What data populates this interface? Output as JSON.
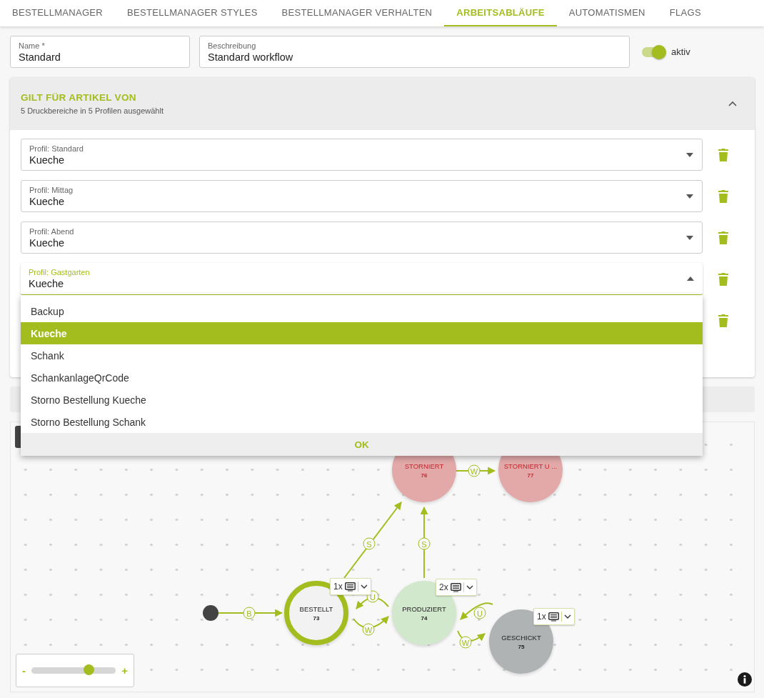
{
  "tabs": [
    {
      "label": "BESTELLMANAGER",
      "selected": false
    },
    {
      "label": "BESTELLMANAGER STYLES",
      "selected": false
    },
    {
      "label": "BESTELLMANAGER VERHALTEN",
      "selected": false
    },
    {
      "label": "ARBEITSABLÄUFE",
      "selected": true
    },
    {
      "label": "AUTOMATISMEN",
      "selected": false
    },
    {
      "label": "FLAGS",
      "selected": false
    }
  ],
  "form": {
    "name": {
      "label": "Name *",
      "value": "Standard"
    },
    "description": {
      "label": "Beschreibung",
      "value": "Standard workflow"
    },
    "active": {
      "label": "aktiv",
      "on": true
    }
  },
  "section": {
    "title": "GILT FÜR ARTIKEL VON",
    "subtitle": "5 Druckbereiche in 5 Profilen ausgewählt",
    "expanded": true
  },
  "profiles": [
    {
      "label": "Profil: Standard",
      "value": "Kueche",
      "open": false
    },
    {
      "label": "Profil: Mittag",
      "value": "Kueche",
      "open": false
    },
    {
      "label": "Profil: Abend",
      "value": "Kueche",
      "open": false
    },
    {
      "label": "Profil: Gastgarten",
      "value": "Kueche",
      "open": true
    },
    {
      "open": false
    }
  ],
  "dropdown": {
    "options": [
      {
        "label": "Backup",
        "selected": false
      },
      {
        "label": "Kueche",
        "selected": true
      },
      {
        "label": "Schank",
        "selected": false
      },
      {
        "label": "SchankanlageQrCode",
        "selected": false
      },
      {
        "label": "Storno Bestellung Kueche",
        "selected": false
      },
      {
        "label": "Storno Bestellung Schank",
        "selected": false
      }
    ],
    "ok": "OK"
  },
  "workflow": {
    "nodes": [
      {
        "kind": "cancel",
        "label": "STORNIERT",
        "number": "76",
        "color": "#e3a9a9",
        "selected": false
      },
      {
        "kind": "cancel",
        "label": "STORNIERT U ...",
        "number": "77",
        "color": "#e3a9a9",
        "selected": false
      },
      {
        "kind": "start"
      },
      {
        "kind": "state",
        "label": "BESTELLT",
        "number": "73",
        "color": "#f2f2f2",
        "selected": true
      },
      {
        "kind": "state",
        "label": "PRODUZIERT",
        "number": "74",
        "color": "#d2e8cc",
        "selected": false
      },
      {
        "kind": "state",
        "label": "GESCHICKT",
        "number": "75",
        "color": "#b0b3b4",
        "selected": false
      }
    ],
    "edges": [
      {
        "letter": "B"
      },
      {
        "letter": "S"
      },
      {
        "letter": "S"
      },
      {
        "letter": "W"
      },
      {
        "letter": "U"
      },
      {
        "letter": "W"
      },
      {
        "letter": "U"
      },
      {
        "letter": "W"
      }
    ],
    "badges": [
      {
        "count": "1x"
      },
      {
        "count": "2x"
      },
      {
        "count": "1x"
      }
    ],
    "zoom": {
      "minus": "-",
      "plus": "+",
      "level": 0.68
    }
  }
}
